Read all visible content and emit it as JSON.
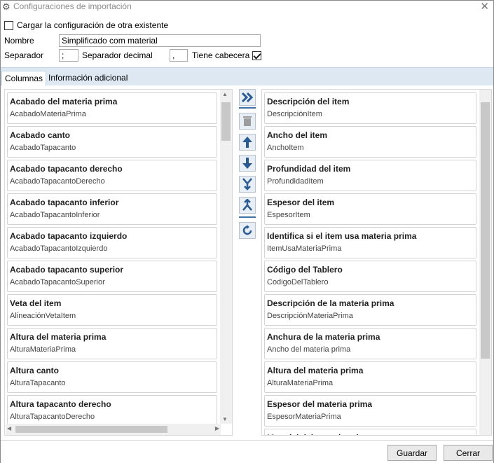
{
  "window": {
    "title": "Configuraciones de importación",
    "close_label": "✕"
  },
  "load_existing": {
    "label": "Cargar la configuración de otra existente",
    "checked": false
  },
  "nombre": {
    "label": "Nombre",
    "value": "Simplificado com material"
  },
  "separador": {
    "label": "Separador",
    "value": ";"
  },
  "separador_decimal": {
    "label": "Separador decimal",
    "value": ","
  },
  "cabecera": {
    "label": "Tiene cabecera",
    "checked": true
  },
  "tabs": [
    {
      "label": "Columnas",
      "active": true
    },
    {
      "label": "Información adicional",
      "active": false
    }
  ],
  "left_list": [
    {
      "title": "Acabado del materia prima",
      "key": "AcabadoMateriaPrima"
    },
    {
      "title": "Acabado canto",
      "key": "AcabadoTapacanto"
    },
    {
      "title": "Acabado tapacanto derecho",
      "key": "AcabadoTapacantoDerecho"
    },
    {
      "title": "Acabado tapacanto inferior",
      "key": "AcabadoTapacantoInferior"
    },
    {
      "title": "Acabado tapacanto izquierdo",
      "key": "AcabadoTapacantoIzquierdo"
    },
    {
      "title": "Acabado tapacanto superior",
      "key": "AcabadoTapacantoSuperior"
    },
    {
      "title": "Veta del item",
      "key": "AlineaciónVetaItem"
    },
    {
      "title": "Altura del materia prima",
      "key": "AlturaMateriaPrima"
    },
    {
      "title": "Altura canto",
      "key": "AlturaTapacanto"
    },
    {
      "title": "Altura tapacanto derecho",
      "key": "AlturaTapacantoDerecho"
    }
  ],
  "right_list": [
    {
      "title": "Descripción del item",
      "key": "DescripciónItem"
    },
    {
      "title": "Ancho del item",
      "key": "AnchoItem"
    },
    {
      "title": "Profundidad del item",
      "key": "ProfundidadItem"
    },
    {
      "title": "Espesor del item",
      "key": "EspesorItem"
    },
    {
      "title": "Identifica si el item usa materia prima",
      "key": "ItemUsaMateriaPrima"
    },
    {
      "title": "Código del Tablero",
      "key": "CodigoDelTablero"
    },
    {
      "title": "Descripción de la materia prima",
      "key": "DescripciónMateriaPrima"
    },
    {
      "title": "Anchura de la materia prima",
      "key": "Ancho del materia prima"
    },
    {
      "title": "Altura del materia prima",
      "key": "AlturaMateriaPrima"
    },
    {
      "title": "Espesor del materia prima",
      "key": "EspesorMateriaPrima"
    },
    {
      "title": "Material del materia prima",
      "key": ""
    }
  ],
  "buttons": {
    "save": "Guardar",
    "close": "Cerrar"
  },
  "colors": {
    "accent": "#2a5a92",
    "tabbar": "#dde8f3",
    "button_face": "#e7eef6"
  }
}
